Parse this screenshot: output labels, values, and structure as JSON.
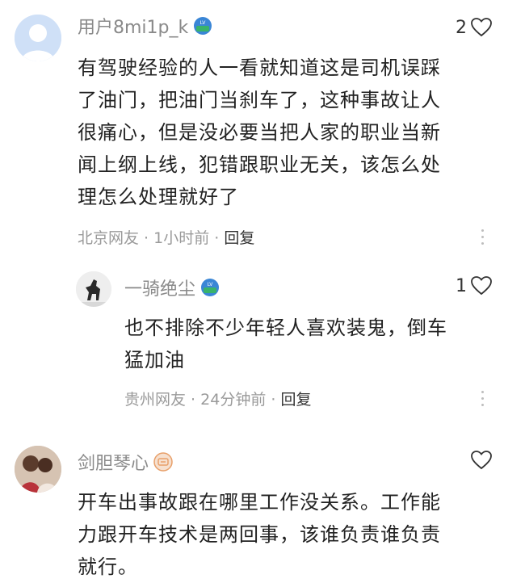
{
  "comments": [
    {
      "username": "用户8mi1p_k",
      "likes": "2",
      "text_lines": [
        "有驾驶经验的人一看就知道这是司机误踩",
        "了油门，把油门当刹车了，这种事故让人",
        "很痛心，但是没必要当把人家的职业当新",
        "闻上纲上线，犯错跟职业无关，该怎么处",
        "理怎么处理就好了"
      ],
      "location": "北京网友",
      "time": "1小时前",
      "reply_label": "回复",
      "badge_icon": "level-badge-icon"
    },
    {
      "username": "一骑绝尘",
      "likes": "1",
      "text_lines": [
        "也不排除不少年轻人喜欢装鬼，倒车",
        "猛加油"
      ],
      "location": "贵州网友",
      "time": "24分钟前",
      "reply_label": "回复",
      "badge_icon": "level-badge-icon"
    },
    {
      "username": "剑胆琴心",
      "likes": "",
      "text_lines": [
        "开车出事故跟在哪里工作没关系。工作能",
        "力跟开车技术是两回事，该谁负责谁负责",
        "就行。"
      ],
      "badge_icon": "orange-badge-icon"
    }
  ],
  "separator": " · ",
  "colors": {
    "username": "#8a8a8a",
    "meta": "#9a9a9a",
    "badge_blue": "#3a86d6",
    "badge_green": "#39b36b",
    "badge_orange": "#e8a06a"
  }
}
